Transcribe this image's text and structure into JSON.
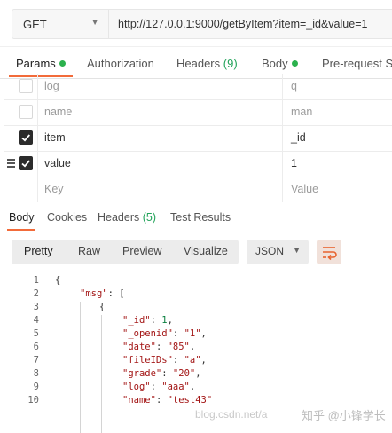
{
  "request": {
    "method": "GET",
    "url": "http://127.0.0.1:9000/getByItem?item=_id&value=1"
  },
  "request_tabs": {
    "params": "Params",
    "authorization": "Authorization",
    "headers": "Headers",
    "headers_count": "(9)",
    "body": "Body",
    "prerequest": "Pre-request Scr"
  },
  "params_table": {
    "rows": [
      {
        "key": "log",
        "value": "q",
        "checked": false
      },
      {
        "key": "name",
        "value": "man",
        "checked": false
      },
      {
        "key": "item",
        "value": "_id",
        "checked": true
      },
      {
        "key": "value",
        "value": "1",
        "checked": true
      }
    ],
    "key_placeholder": "Key",
    "value_placeholder": "Value"
  },
  "response_tabs": {
    "body": "Body",
    "cookies": "Cookies",
    "headers": "Headers",
    "headers_count": "(5)",
    "test_results": "Test Results"
  },
  "view_modes": {
    "pretty": "Pretty",
    "raw": "Raw",
    "preview": "Preview",
    "visualize": "Visualize",
    "format": "JSON"
  },
  "code_lines": [
    {
      "n": "1",
      "text": "{"
    },
    {
      "n": "2",
      "key": "\"msg\"",
      "rest": ": ["
    },
    {
      "n": "3",
      "text": "{"
    },
    {
      "n": "4",
      "key": "\"_id\"",
      "sep": ": ",
      "val": "1",
      "kind": "num",
      "tail": ","
    },
    {
      "n": "5",
      "key": "\"_openid\"",
      "sep": ": ",
      "val": "\"1\"",
      "kind": "str",
      "tail": ","
    },
    {
      "n": "6",
      "key": "\"date\"",
      "sep": ": ",
      "val": "\"85\"",
      "kind": "str",
      "tail": ","
    },
    {
      "n": "7",
      "key": "\"fileIDs\"",
      "sep": ": ",
      "val": "\"a\"",
      "kind": "str",
      "tail": ","
    },
    {
      "n": "8",
      "key": "\"grade\"",
      "sep": ": ",
      "val": "\"20\"",
      "kind": "str",
      "tail": ","
    },
    {
      "n": "9",
      "key": "\"log\"",
      "sep": ": ",
      "val": "\"aaa\"",
      "kind": "str",
      "tail": ","
    },
    {
      "n": "10",
      "key": "\"name\"",
      "sep": ": ",
      "val": "\"test43\"",
      "kind": "str",
      "tail": ""
    }
  ],
  "watermark": {
    "url_text": "blog.csdn.net/a",
    "brand_text": "知乎 @小锋学长"
  },
  "colors": {
    "accent": "#f26b3a",
    "status_dot": "#2bb14d"
  },
  "icons": {
    "method_dropdown": "chevron-down-icon",
    "wrap_toggle": "wrap-lines-icon",
    "drag_handle": "drag-handle-icon",
    "checkbox": "checkmark-icon"
  }
}
